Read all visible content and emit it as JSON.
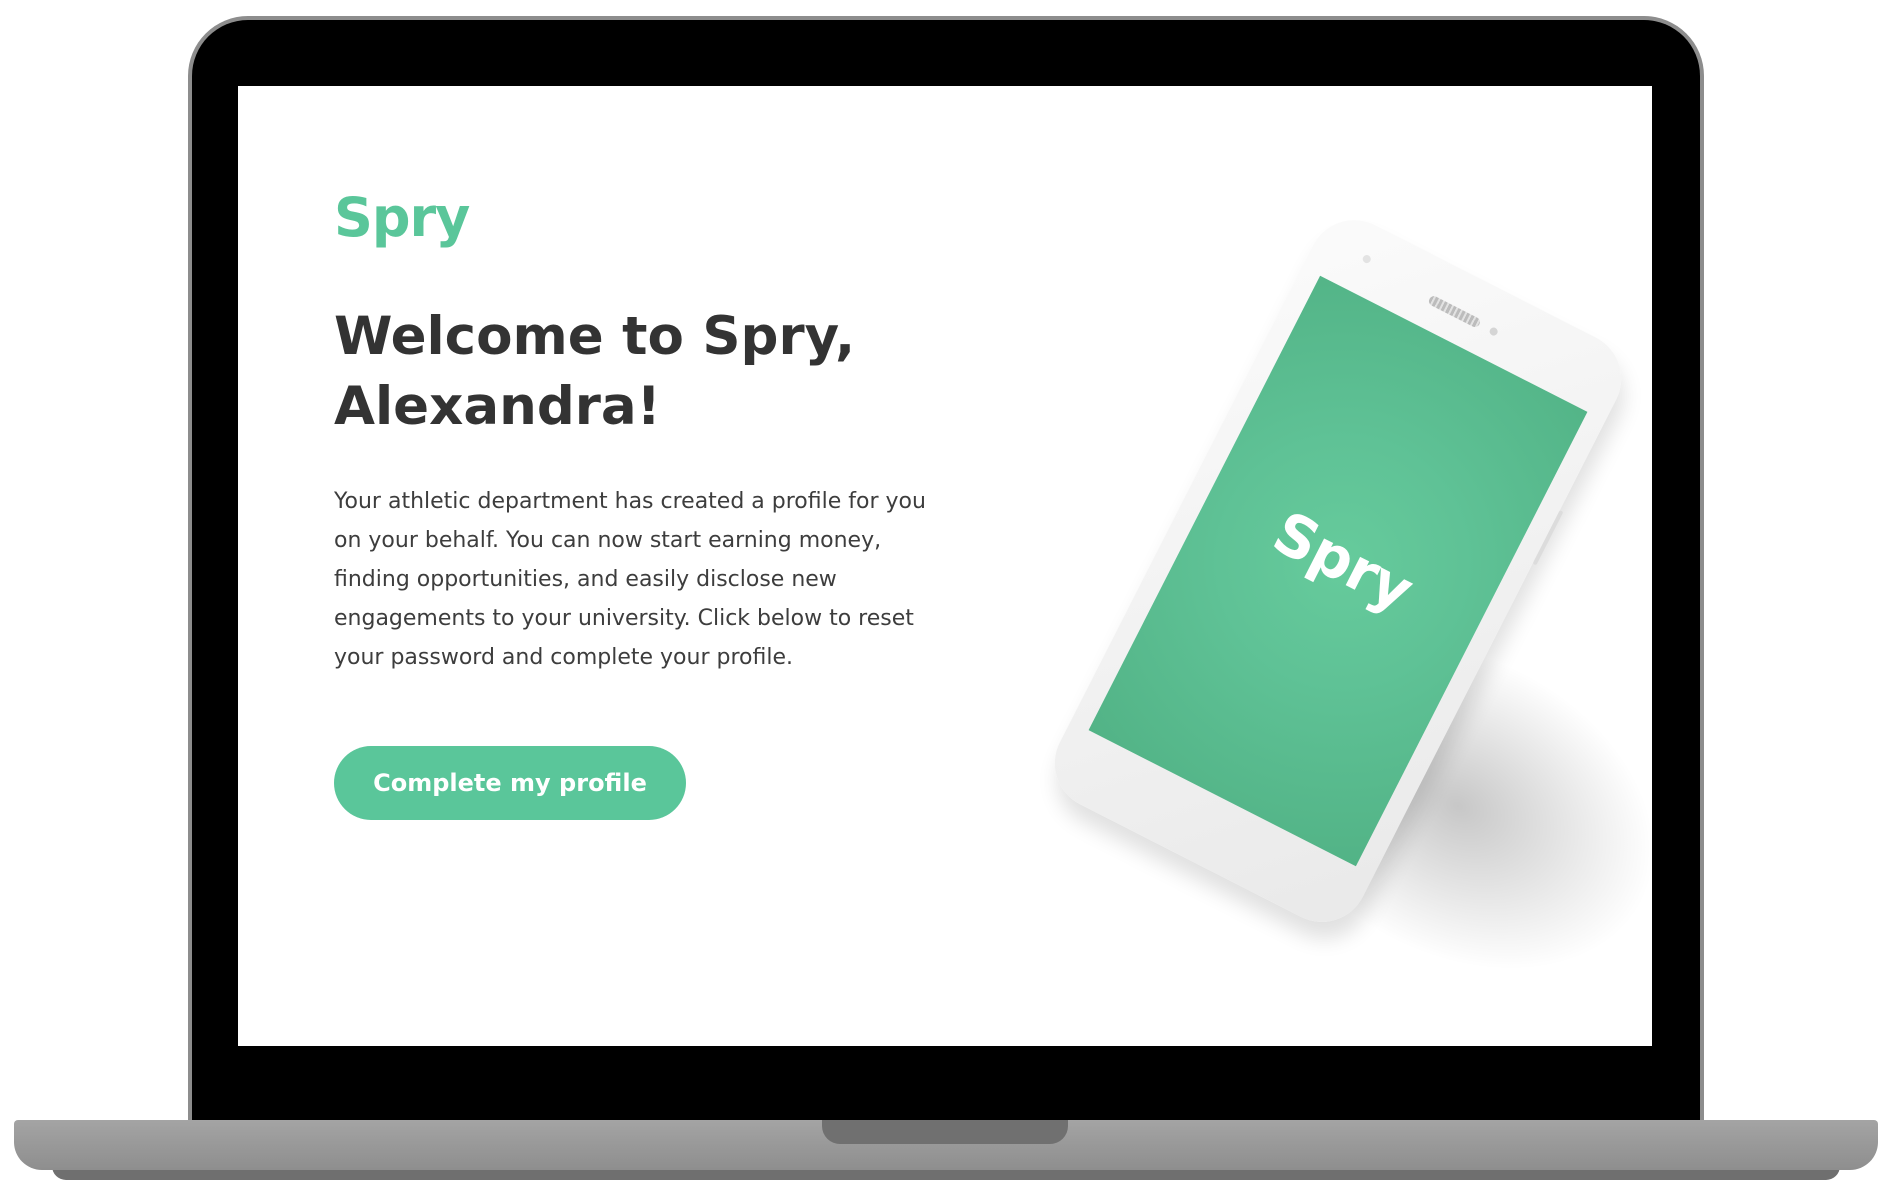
{
  "brand": {
    "name": "Spry",
    "accent_color": "#5ac69a"
  },
  "welcome": {
    "heading": "Welcome to Spry, Alexandra!",
    "body": "Your athletic department has created a profile for you on your behalf. You can now start earning money, finding opportunities, and easily disclose new engagements to your university. Click below to reset your password and complete your profile."
  },
  "cta": {
    "label": "Complete my profile"
  },
  "phone": {
    "screen_logo": "Spry",
    "screen_color": "#5fc296"
  }
}
